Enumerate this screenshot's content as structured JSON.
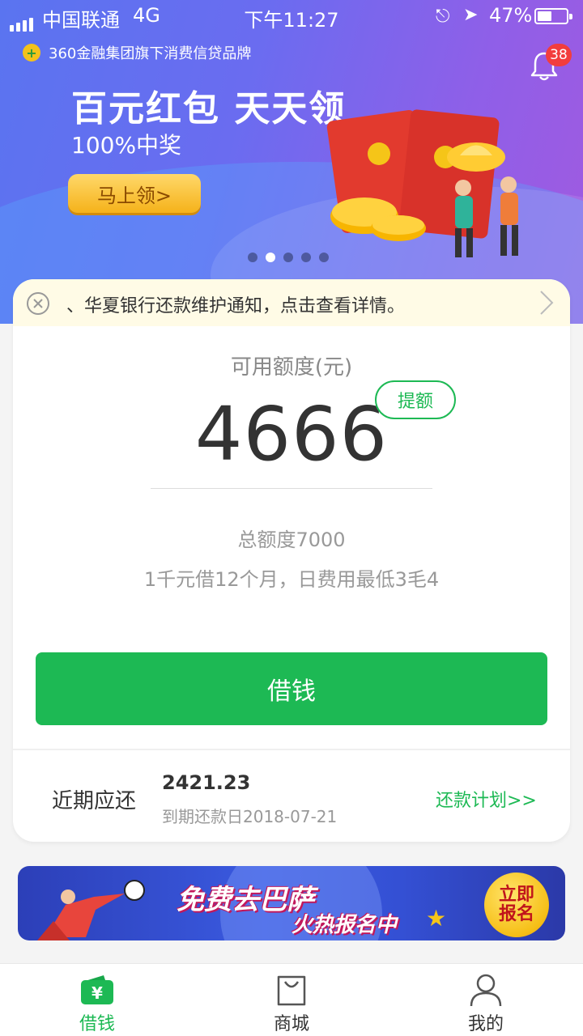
{
  "status_bar": {
    "carrier": "中国联通",
    "network": "4G",
    "time": "下午11:27",
    "battery": "47%"
  },
  "hero": {
    "brand": "360金融集团旗下消费信贷品牌",
    "notification_count": "38",
    "title": "百元红包 天天领",
    "subtitle": "100%中奖",
    "cta": "马上领>",
    "slide_count": 5,
    "active_slide": 2
  },
  "notice": {
    "text": "、华夏银行还款维护通知，点击查看详情。"
  },
  "credit": {
    "label": "可用额度(元)",
    "amount": "4666",
    "raise_label": "提额",
    "total": "总额度7000",
    "promo": "1千元借12个月，日费用最低3毛4",
    "borrow_label": "借钱"
  },
  "repayment": {
    "label": "近期应还",
    "amount": "2421.23",
    "due_date": "到期还款日2018-07-21",
    "plan_link": "还款计划>>"
  },
  "promo_banner": {
    "title1": "免费去巴萨",
    "title2": "火热报名中",
    "signup": "立即报名"
  },
  "tabs": [
    {
      "label": "借钱",
      "icon": "wallet-icon",
      "active": true
    },
    {
      "label": "商城",
      "icon": "shopping-bag-icon",
      "active": false
    },
    {
      "label": "我的",
      "icon": "user-icon",
      "active": false
    }
  ],
  "colors": {
    "accent": "#1db954",
    "badge": "#f23d3d",
    "notice_bg": "#fffbe6"
  }
}
